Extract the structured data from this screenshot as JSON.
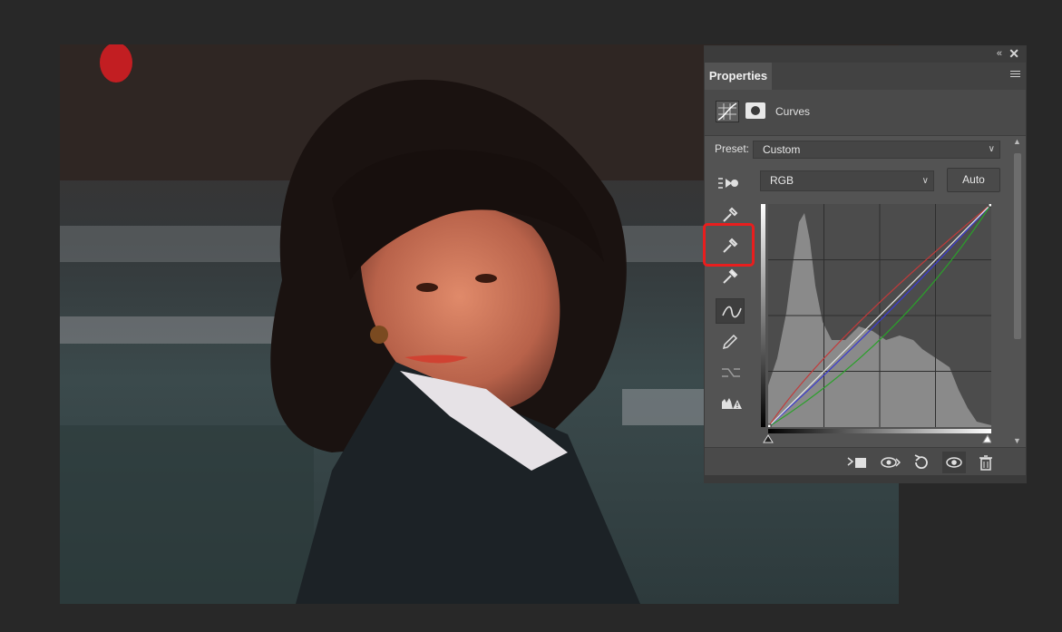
{
  "panel": {
    "tab_label": "Properties",
    "adjustment_name": "Curves",
    "preset_label": "Preset:",
    "preset_value": "Custom",
    "channel_value": "RGB",
    "auto_label": "Auto"
  },
  "curves": {
    "channels": [
      {
        "name": "rgb",
        "color": "#e8e8e8",
        "points": [
          [
            0,
            0
          ],
          [
            255,
            255
          ]
        ]
      },
      {
        "name": "red",
        "color": "#c23a3a",
        "points": [
          [
            0,
            0
          ],
          [
            96,
            112
          ],
          [
            255,
            255
          ]
        ]
      },
      {
        "name": "green",
        "color": "#2aa12a",
        "points": [
          [
            0,
            0
          ],
          [
            140,
            112
          ],
          [
            255,
            255
          ]
        ]
      },
      {
        "name": "blue",
        "color": "#3b3bd0",
        "points": [
          [
            0,
            0
          ],
          [
            128,
            122
          ],
          [
            255,
            255
          ]
        ]
      }
    ]
  },
  "colors": {
    "highlight": "#e81e1e",
    "panel_bg": "#535353"
  }
}
